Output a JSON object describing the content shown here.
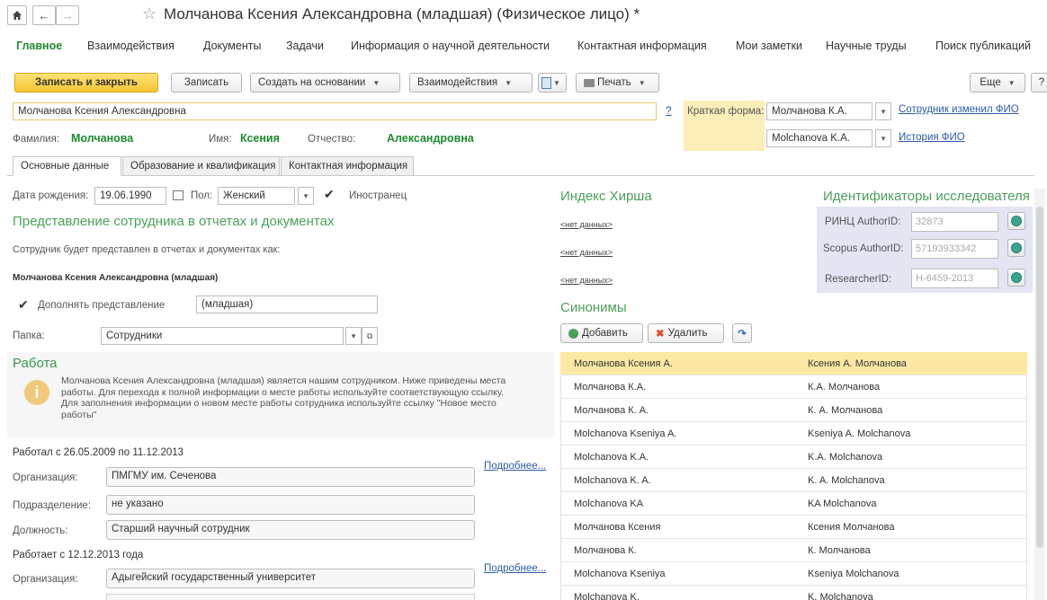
{
  "window": {
    "title": "Молчанова Ксения Александровна (младшая) (Физическое лицо) *"
  },
  "sections": [
    {
      "label": "Главное",
      "active": true
    },
    {
      "label": "Взаимодействия"
    },
    {
      "label": "Документы"
    },
    {
      "label": "Задачи"
    },
    {
      "label": "Информация о научной деятельности"
    },
    {
      "label": "Контактная информация"
    },
    {
      "label": "Мои заметки"
    },
    {
      "label": "Научные труды"
    },
    {
      "label": "Поиск публикаций"
    }
  ],
  "toolbar": {
    "save_close": "Записать и закрыть",
    "save": "Записать",
    "create_based": "Создать на основании",
    "interactions": "Взаимодействия",
    "print": "Печать",
    "more": "Еще",
    "help": "?"
  },
  "header": {
    "full_name": "Молчанова Ксения Александровна",
    "help_mark": "?",
    "short_form_label": "Краткая форма:",
    "short_form_value": "Молчанова К.А.",
    "short_form_value_latin": "Molchanova K.A.",
    "employee_changed_link": "Сотрудник изменил ФИО",
    "name_history_link": "История ФИО",
    "surname_label": "Фамилия:",
    "surname": "Молчанова",
    "name_label": "Имя:",
    "name": "Ксения",
    "patronymic_label": "Отчество:",
    "patronymic": "Александровна"
  },
  "tabs": [
    {
      "label": "Основные данные",
      "active": true
    },
    {
      "label": "Образование и квалификация"
    },
    {
      "label": "Контактная информация"
    }
  ],
  "basic": {
    "birth_label": "Дата рождения:",
    "birth_date": "19.06.1990",
    "sex_label": "Пол:",
    "sex": "Женский",
    "foreigner_label": "Иностранец",
    "representation_header": "Представление сотрудника в отчетах и документах",
    "representation_text": "Сотрудник будет представлен в отчетах и документах как:",
    "representation_value": "Молчанова Ксения Александровна (младшая)",
    "supplement_label": "Дополнять представление",
    "supplement_value": "(младшая)",
    "folder_label": "Папка:",
    "folder_value": "Сотрудники"
  },
  "work": {
    "header": "Работа",
    "info_lines": [
      "Молчанова Ксения Александровна (младшая) является нашим сотрудником. Ниже приведены места",
      "работы. Для перехода к полной информации о месте работы используйте соответствующую ссылку.",
      "Для заполнения информации о новом месте работы сотрудника используйте ссылку \"Новое место",
      "работы\""
    ],
    "job1_period": "Работал с 26.05.2009 по 11.12.2013",
    "org_label": "Организация:",
    "job1_org": "ПМГМУ им. Сеченова",
    "dept_label": "Подразделение:",
    "job1_dept": "не указано",
    "position_label": "Должность:",
    "job1_position": "Старший научный сотрудник",
    "more_link": "Подробнее...",
    "job2_period": "Работает с 12.12.2013 года",
    "job2_org": "Адыгейский государственный университет"
  },
  "hirsch": {
    "header": "Индекс Хирша",
    "no_data": "<нет данных>"
  },
  "ids": {
    "header": "Идентификаторы исследователя",
    "rinc_label": "РИНЦ AuthorID:",
    "rinc_value": "32873",
    "scopus_label": "Scopus AuthorID:",
    "scopus_value": "57193933342",
    "researcher_label": "ResearcherID:",
    "researcher_value": "H-6459-2013"
  },
  "synonyms": {
    "header": "Синонимы",
    "add": "Добавить",
    "delete": "Удалить",
    "rows": [
      [
        "Молчанова Ксения А.",
        "Ксения А. Молчанова"
      ],
      [
        "Молчанова К.А.",
        "К.А. Молчанова"
      ],
      [
        "Молчанова К. А.",
        "К. А. Молчанова"
      ],
      [
        "Molchanova Kseniya A.",
        "Kseniya A. Molchanova"
      ],
      [
        "Molchanova K.A.",
        "K.A. Molchanova"
      ],
      [
        "Molchanova K. A.",
        "K. A. Molchanova"
      ],
      [
        "Molchanova KA",
        "KA Molchanova"
      ],
      [
        "Молчанова Ксения",
        "Ксения Молчанова"
      ],
      [
        "Молчанова К.",
        "К. Молчанова"
      ],
      [
        "Molchanova Kseniya",
        "Kseniya Molchanova"
      ],
      [
        "Molchanova K.",
        "K. Molchanova"
      ]
    ]
  },
  "colors": {
    "accent_green": "#1e8b2e",
    "primary_button": "#f5c531",
    "selected_row": "#fbe8a3",
    "highlight_panel": "#fbeeb8",
    "ids_panel": "#e3e5f3"
  }
}
